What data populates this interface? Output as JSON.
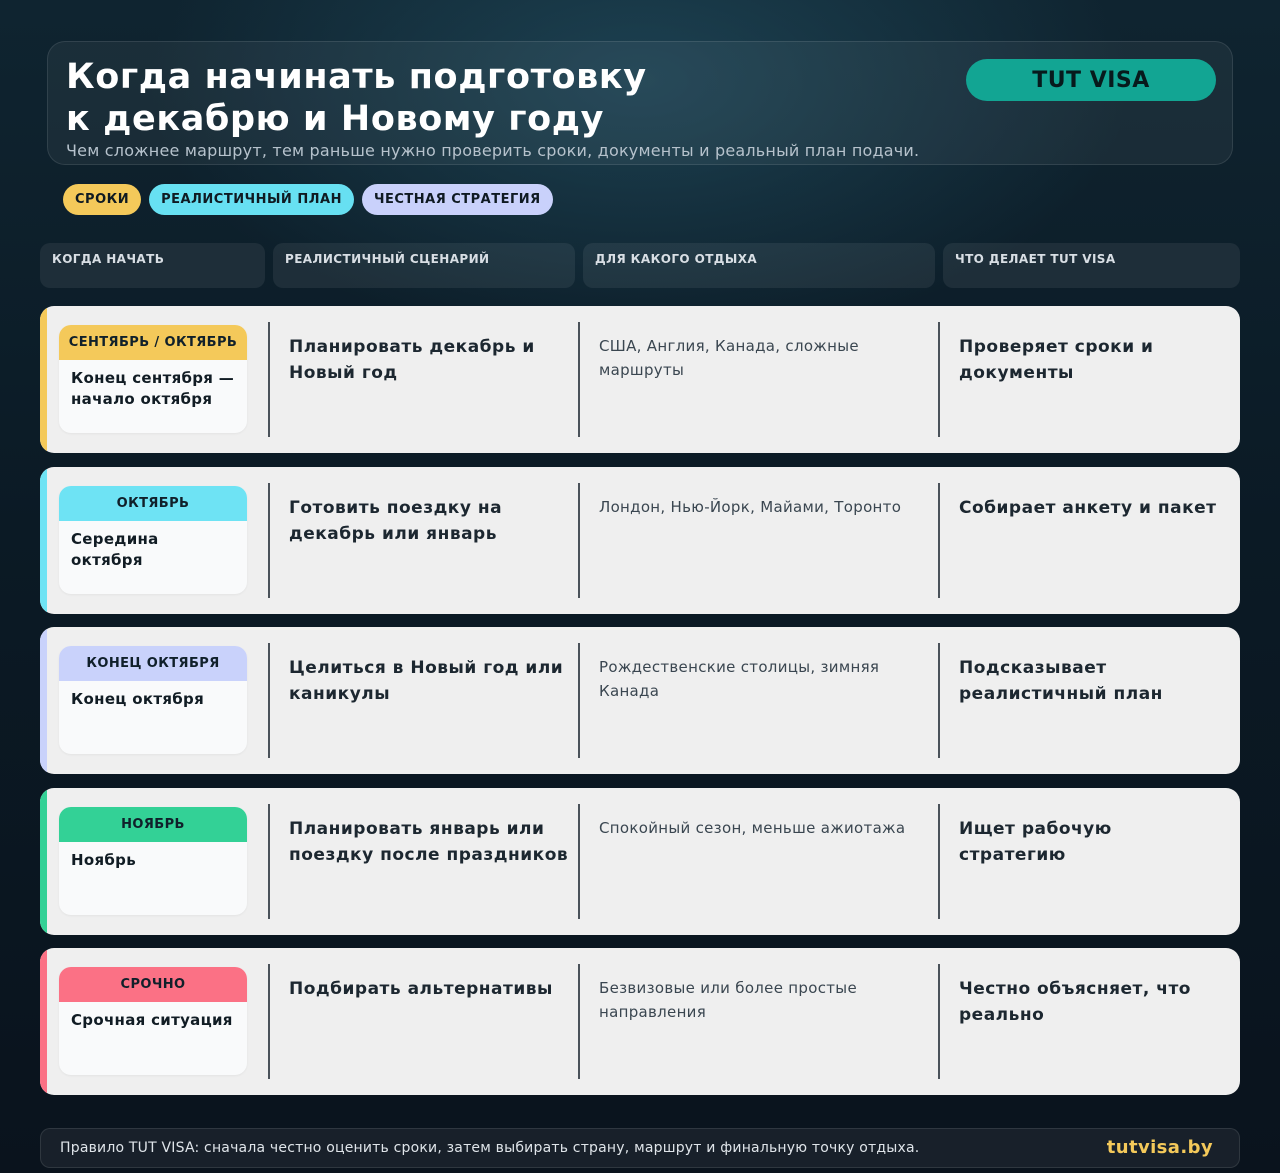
{
  "header": {
    "title": "Когда начинать подготовку\nк декабрю и Новому году",
    "subtitle": "Чем сложнее маршрут, тем раньше нужно проверить сроки, документы и реальный план подачи.",
    "brand": "TUT VISA"
  },
  "chips": [
    {
      "label": "СРОКИ",
      "color": "#f4c95a"
    },
    {
      "label": "РЕАЛИСТИЧНЫЙ ПЛАН",
      "color": "#67e0f2"
    },
    {
      "label": "ЧЕСТНАЯ СТРАТЕГИЯ",
      "color": "#c9d1fb"
    }
  ],
  "columns": [
    "КОГДА НАЧАТЬ",
    "РЕАЛИСТИЧНЫЙ СЦЕНАРИЙ",
    "ДЛЯ КАКОГО ОТДЫХА",
    "ЧТО ДЕЛАЕТ TUT VISA"
  ],
  "rows": [
    {
      "tag": "СЕНТЯБРЬ / ОКТЯБРЬ",
      "when": "Конец сентября — начало октября",
      "scenario": "Планировать декабрь и Новый год",
      "destinations": "США, Англия, Канада, сложные маршруты",
      "action": "Проверяет сроки и документы",
      "color": "#f4c95a"
    },
    {
      "tag": "ОКТЯБРЬ",
      "when": "Середина октября",
      "scenario": "Готовить поездку на декабрь или январь",
      "destinations": "Лондон, Нью-Йорк, Майами, Торонто",
      "action": "Собирает анкету и пакет",
      "color": "#6ee3f4"
    },
    {
      "tag": "КОНЕЦ ОКТЯБРЯ",
      "when": "Конец октября",
      "scenario": "Целиться в Новый год или каникулы",
      "destinations": "Рождественские столицы, зимняя Канада",
      "action": "Подсказывает реалистичный план",
      "color": "#c9d2fb"
    },
    {
      "tag": "НОЯБРЬ",
      "when": "Ноябрь",
      "scenario": "Планировать январь или поездку после праздников",
      "destinations": "Спокойный сезон, меньше ажиотажа",
      "action": "Ищет рабочую стратегию",
      "color": "#33d196"
    },
    {
      "tag": "СРОЧНО",
      "when": "Срочная ситуация",
      "scenario": "Подбирать альтернативы",
      "destinations": "Безвизовые или более простые направления",
      "action": "Честно объясняет, что реально",
      "color": "#fb7185"
    }
  ],
  "footer": {
    "note": "Правило TUT VISA: сначала честно оценить сроки, затем выбирать страну, маршрут и финальную точку отдыха.",
    "site": "tutvisa.by"
  }
}
